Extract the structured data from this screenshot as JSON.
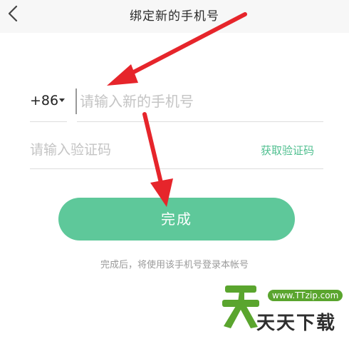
{
  "header": {
    "title": "绑定新的手机号",
    "back_icon": "chevron-left-icon"
  },
  "form": {
    "country_code": "+86",
    "phone_placeholder": "请输入新的手机号",
    "code_placeholder": "请输入验证码",
    "get_code_label": "获取验证码"
  },
  "submit_label": "完成",
  "hint": "完成后，将使用该手机号登录本帐号",
  "watermark": {
    "url": "www.TTzip.com",
    "text": "天天下载"
  },
  "colors": {
    "accent": "#5ec89a",
    "accent_text": "#4fbf8f",
    "annotation_arrow": "#e6252b",
    "watermark_green": "#5aa52e"
  }
}
